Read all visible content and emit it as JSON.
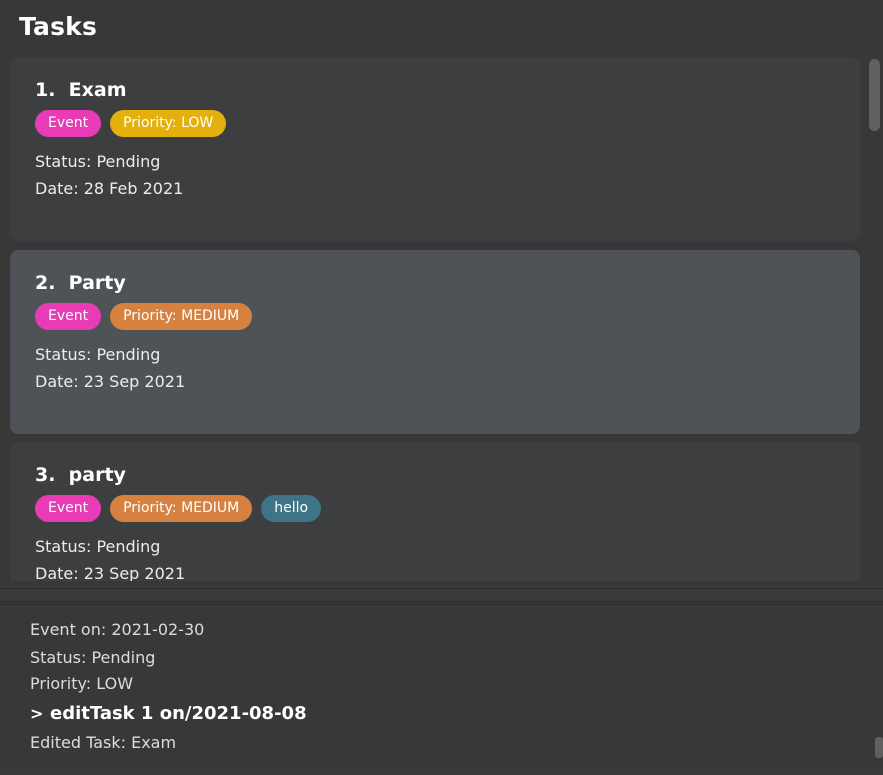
{
  "tasks_panel": {
    "title": "Tasks"
  },
  "tasks": [
    {
      "name": "1.  Exam",
      "tags": [
        {
          "label": "Event",
          "kind": "event"
        },
        {
          "label": "Priority: LOW",
          "kind": "low"
        }
      ],
      "status": "Status: Pending",
      "date": "Date: 28 Feb 2021",
      "selected": false
    },
    {
      "name": "2.  Party",
      "tags": [
        {
          "label": "Event",
          "kind": "event"
        },
        {
          "label": "Priority: MEDIUM",
          "kind": "medium"
        }
      ],
      "status": "Status: Pending",
      "date": "Date: 23 Sep 2021",
      "selected": true
    },
    {
      "name": "3.  party",
      "tags": [
        {
          "label": "Event",
          "kind": "event"
        },
        {
          "label": "Priority: MEDIUM",
          "kind": "medium"
        },
        {
          "label": "hello",
          "kind": "custom"
        }
      ],
      "status": "Status: Pending",
      "date": "Date: 23 Sep 2021",
      "selected": false
    }
  ],
  "result_display": {
    "lines": [
      "Event on: 2021-02-30",
      "Status: Pending",
      "Priority: LOW"
    ],
    "command": "editTask 1 on/2021-08-08",
    "command_prefix": ">",
    "feedback": "Edited Task: Exam"
  },
  "colors": {
    "background": "#383838",
    "card": "#3d3e40",
    "card_selected": "#4f5357",
    "tag_event": "#e83cb7",
    "tag_low": "#e4b00b",
    "tag_medium": "#d6813f",
    "tag_custom": "#3f7488"
  }
}
